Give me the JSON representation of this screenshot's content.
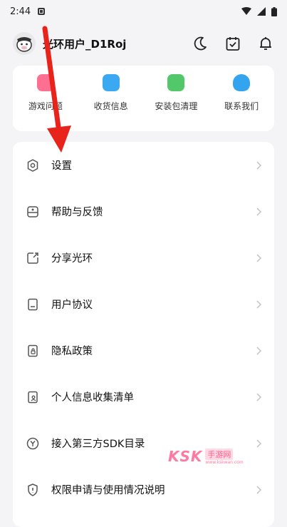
{
  "status_bar": {
    "time": "2:44"
  },
  "header": {
    "username": "光环用户_D1Roj"
  },
  "shortcuts": [
    {
      "label": "游戏问题",
      "color": "#ff6f91"
    },
    {
      "label": "收货信息",
      "color": "#3aa9f2"
    },
    {
      "label": "安装包清理",
      "color": "#52c86b"
    },
    {
      "label": "联系我们",
      "color": "#35a4ee"
    }
  ],
  "menu": [
    {
      "label": "设置",
      "icon": "gear-icon"
    },
    {
      "label": "帮助与反馈",
      "icon": "help-feedback-icon"
    },
    {
      "label": "分享光环",
      "icon": "share-icon"
    },
    {
      "label": "用户协议",
      "icon": "agreement-icon"
    },
    {
      "label": "隐私政策",
      "icon": "privacy-icon"
    },
    {
      "label": "个人信息收集清单",
      "icon": "personal-info-icon"
    },
    {
      "label": "接入第三方SDK目录",
      "icon": "sdk-icon"
    },
    {
      "label": "权限申请与使用情况说明",
      "icon": "permission-icon"
    }
  ],
  "watermark": {
    "brand": "KSK",
    "cn": "手游网",
    "url": "www.kskwan.com"
  },
  "colors": {
    "accent_arrow": "#e8231b",
    "card": "#ffffff",
    "background": "#f4f4f6"
  }
}
